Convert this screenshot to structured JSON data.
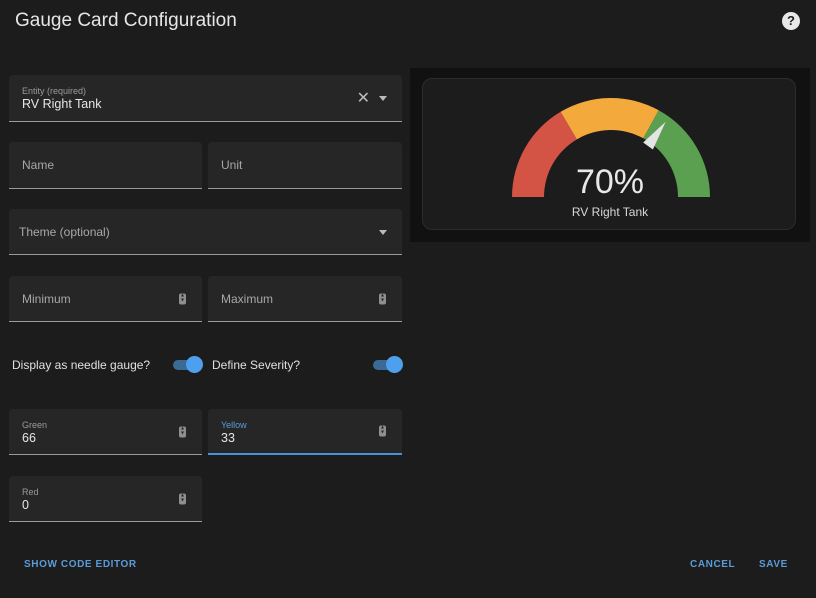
{
  "dialog": {
    "title": "Gauge Card Configuration",
    "help_icon": "help-circle-icon"
  },
  "form": {
    "entity": {
      "label": "Entity (required)",
      "value": "RV Right Tank",
      "clear_icon": "close-icon",
      "dropdown_icon": "menu-down-icon"
    },
    "name": {
      "placeholder": "Name"
    },
    "unit": {
      "placeholder": "Unit"
    },
    "theme": {
      "placeholder": "Theme (optional)",
      "dropdown_icon": "menu-down-icon"
    },
    "minimum": {
      "placeholder": "Minimum"
    },
    "maximum": {
      "placeholder": "Maximum"
    },
    "needle_toggle": {
      "label": "Display as needle gauge?",
      "checked": true
    },
    "severity_toggle": {
      "label": "Define Severity?",
      "checked": true
    },
    "green": {
      "label": "Green",
      "value": "66"
    },
    "yellow": {
      "label": "Yellow",
      "value": "33",
      "focused": true
    },
    "red": {
      "label": "Red",
      "value": "0"
    }
  },
  "preview": {
    "value": 70,
    "display_value": "70%",
    "name": "RV Right Tank",
    "min": 0,
    "max": 100,
    "severity": [
      {
        "name": "red",
        "from": 0,
        "to": 33,
        "color": "#d35445"
      },
      {
        "name": "yellow",
        "from": 33,
        "to": 66,
        "color": "#f4a93c"
      },
      {
        "name": "green",
        "from": 66,
        "to": 100,
        "color": "#5b9f51"
      }
    ],
    "needle_color": "#e4e4e4"
  },
  "footer": {
    "show_code_editor": "SHOW CODE EDITOR",
    "cancel": "CANCEL",
    "save": "SAVE"
  },
  "colors": {
    "accent": "#4ea0ee",
    "link": "#5b9bd9"
  }
}
